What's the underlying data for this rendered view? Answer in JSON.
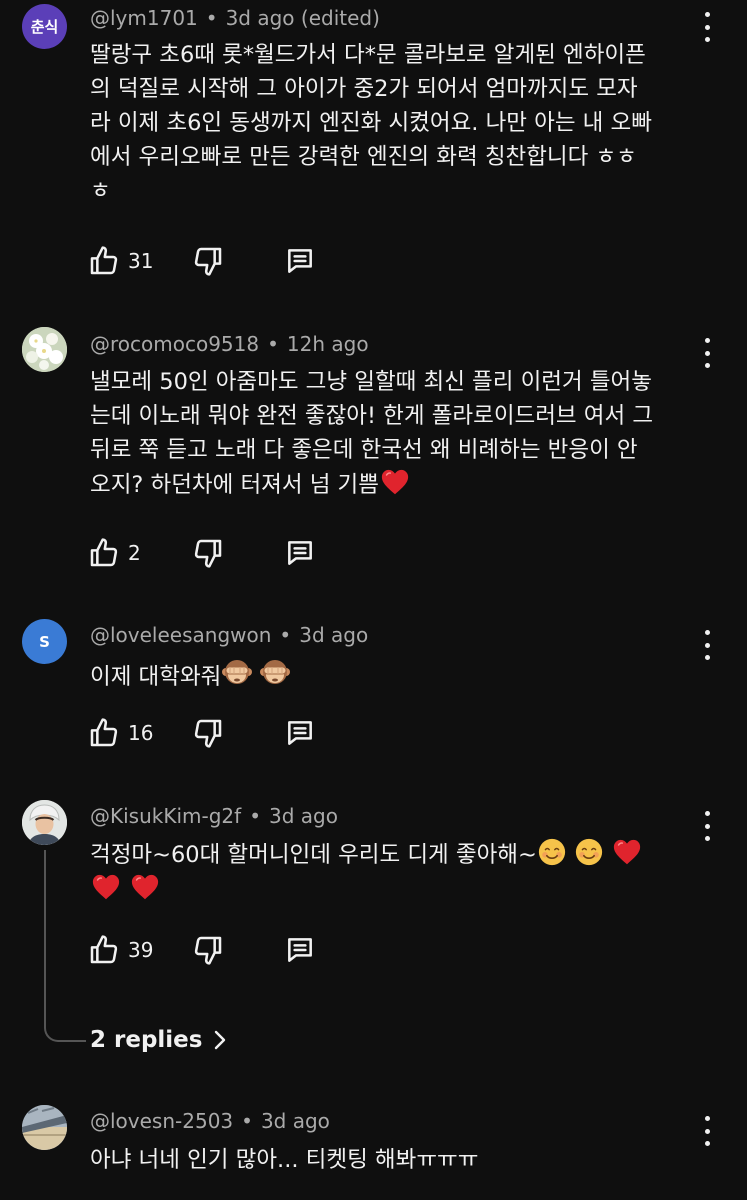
{
  "comments": [
    {
      "avatar_text": "춘식",
      "avatar_color": "#5b3fb8",
      "handle": "@lym1701",
      "time": "3d ago",
      "edited": "(edited)",
      "text": "딸랑구 초6때 롯*월드가서 다*문 콜라보로 알게된 엔하이픈\n의 덕질로 시작해 그 아이가 중2가 되어서 엄마까지도 모자\n라 이제 초6인 동생까지 엔진화 시켰어요. 나만 아는 내 오빠\n에서 우리오빠로 만든 강력한 엔진의 화력 칭찬합니다 ㅎㅎ\nㅎ",
      "likes": "31"
    },
    {
      "handle": "@rocomoco9518",
      "time": "12h ago",
      "text": "낼모레 50인 아줌마도 그냥 일할때 최신 플리 이런거 틀어놓\n는데 이노래 뭐야 완전 좋잖아! 한게 폴라로이드러브 여서 그\n뒤로 쭉 듣고 노래 다 좋은데 한국선 왜 비례하는 반응이 안\n오지? 하던차에 터져서 넘 기쁨",
      "likes": "2"
    },
    {
      "avatar_text": "S",
      "avatar_color": "#3a7bd5",
      "handle": "@loveleesangwon",
      "time": "3d ago",
      "text": "이제 대학와줘",
      "likes": "16"
    },
    {
      "handle": "@KisukKim-g2f",
      "time": "3d ago",
      "text": "걱정마~60대 할머니인데 우리도 디게 좋아해~",
      "likes": "39",
      "replies_label": "2 replies"
    },
    {
      "handle": "@lovesn-2503",
      "time": "3d ago",
      "text": "아냐 너네 인기 많아... 티켓팅 해봐ㅠㅠㅠ"
    }
  ],
  "colors": {
    "background": "#0f0f0f",
    "text": "#f1f1f1",
    "meta": "#aaaaaa",
    "heart": "#e0242d"
  },
  "icons": [
    "like-icon",
    "dislike-icon",
    "reply-icon",
    "more-vert-icon",
    "chevron-right-icon",
    "heart-emoji",
    "monkey-emoji",
    "smile-emoji"
  ]
}
